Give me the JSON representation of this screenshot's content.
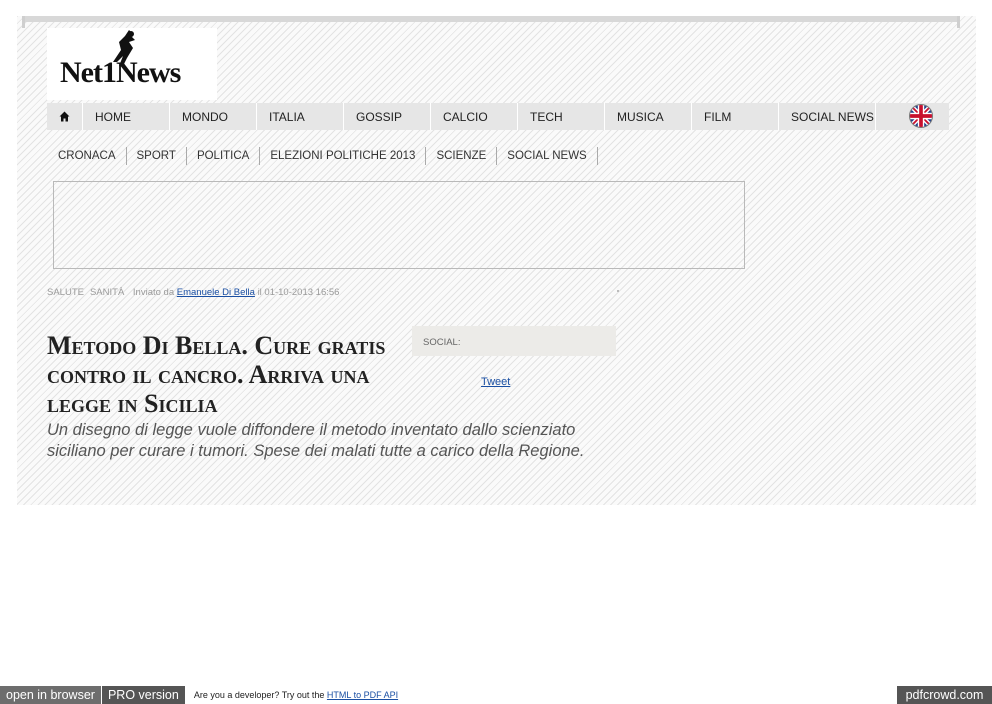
{
  "logo": {
    "text": "Net1News"
  },
  "nav": {
    "items": [
      "HOME",
      "MONDO",
      "ITALIA",
      "GOSSIP",
      "CALCIO",
      "TECH",
      "MUSICA",
      "FILM",
      "SOCIAL NEWS"
    ]
  },
  "subnav": {
    "items": [
      "CRONACA",
      "SPORT",
      "POLITICA",
      "ELEZIONI POLITICHE 2013",
      "SCIENZE",
      "SOCIAL NEWS"
    ]
  },
  "article": {
    "tags": [
      "SALUTE",
      "SANITÀ"
    ],
    "posted_by_label": "Inviato da",
    "author": "Emanuele Di Bella",
    "date_text": "il 01-10-2013 16:56",
    "title": "Metodo Di Bella. Cure gratis contro il cancro. Arriva una legge in Sicilia",
    "subtitle": "Un disegno di legge vuole diffondere il metodo inventato dallo scienziato siciliano per curare i tumori. Spese dei malati tutte a carico della Regione."
  },
  "social": {
    "label": "SOCIAL:",
    "tweet_label": "Tweet"
  },
  "footer": {
    "open_in_browser": "open in browser",
    "pro_version": "PRO version",
    "developer_text": "Are you a developer? Try out the",
    "api_link": "HTML to PDF API",
    "brand": "pdfcrowd.com"
  },
  "colors": {
    "link": "#1a4fa3",
    "nav_bg": "#e6e6e6",
    "footer_dark": "#555555"
  },
  "icons": {
    "home": "home-icon",
    "flag": "uk-flag-icon"
  }
}
